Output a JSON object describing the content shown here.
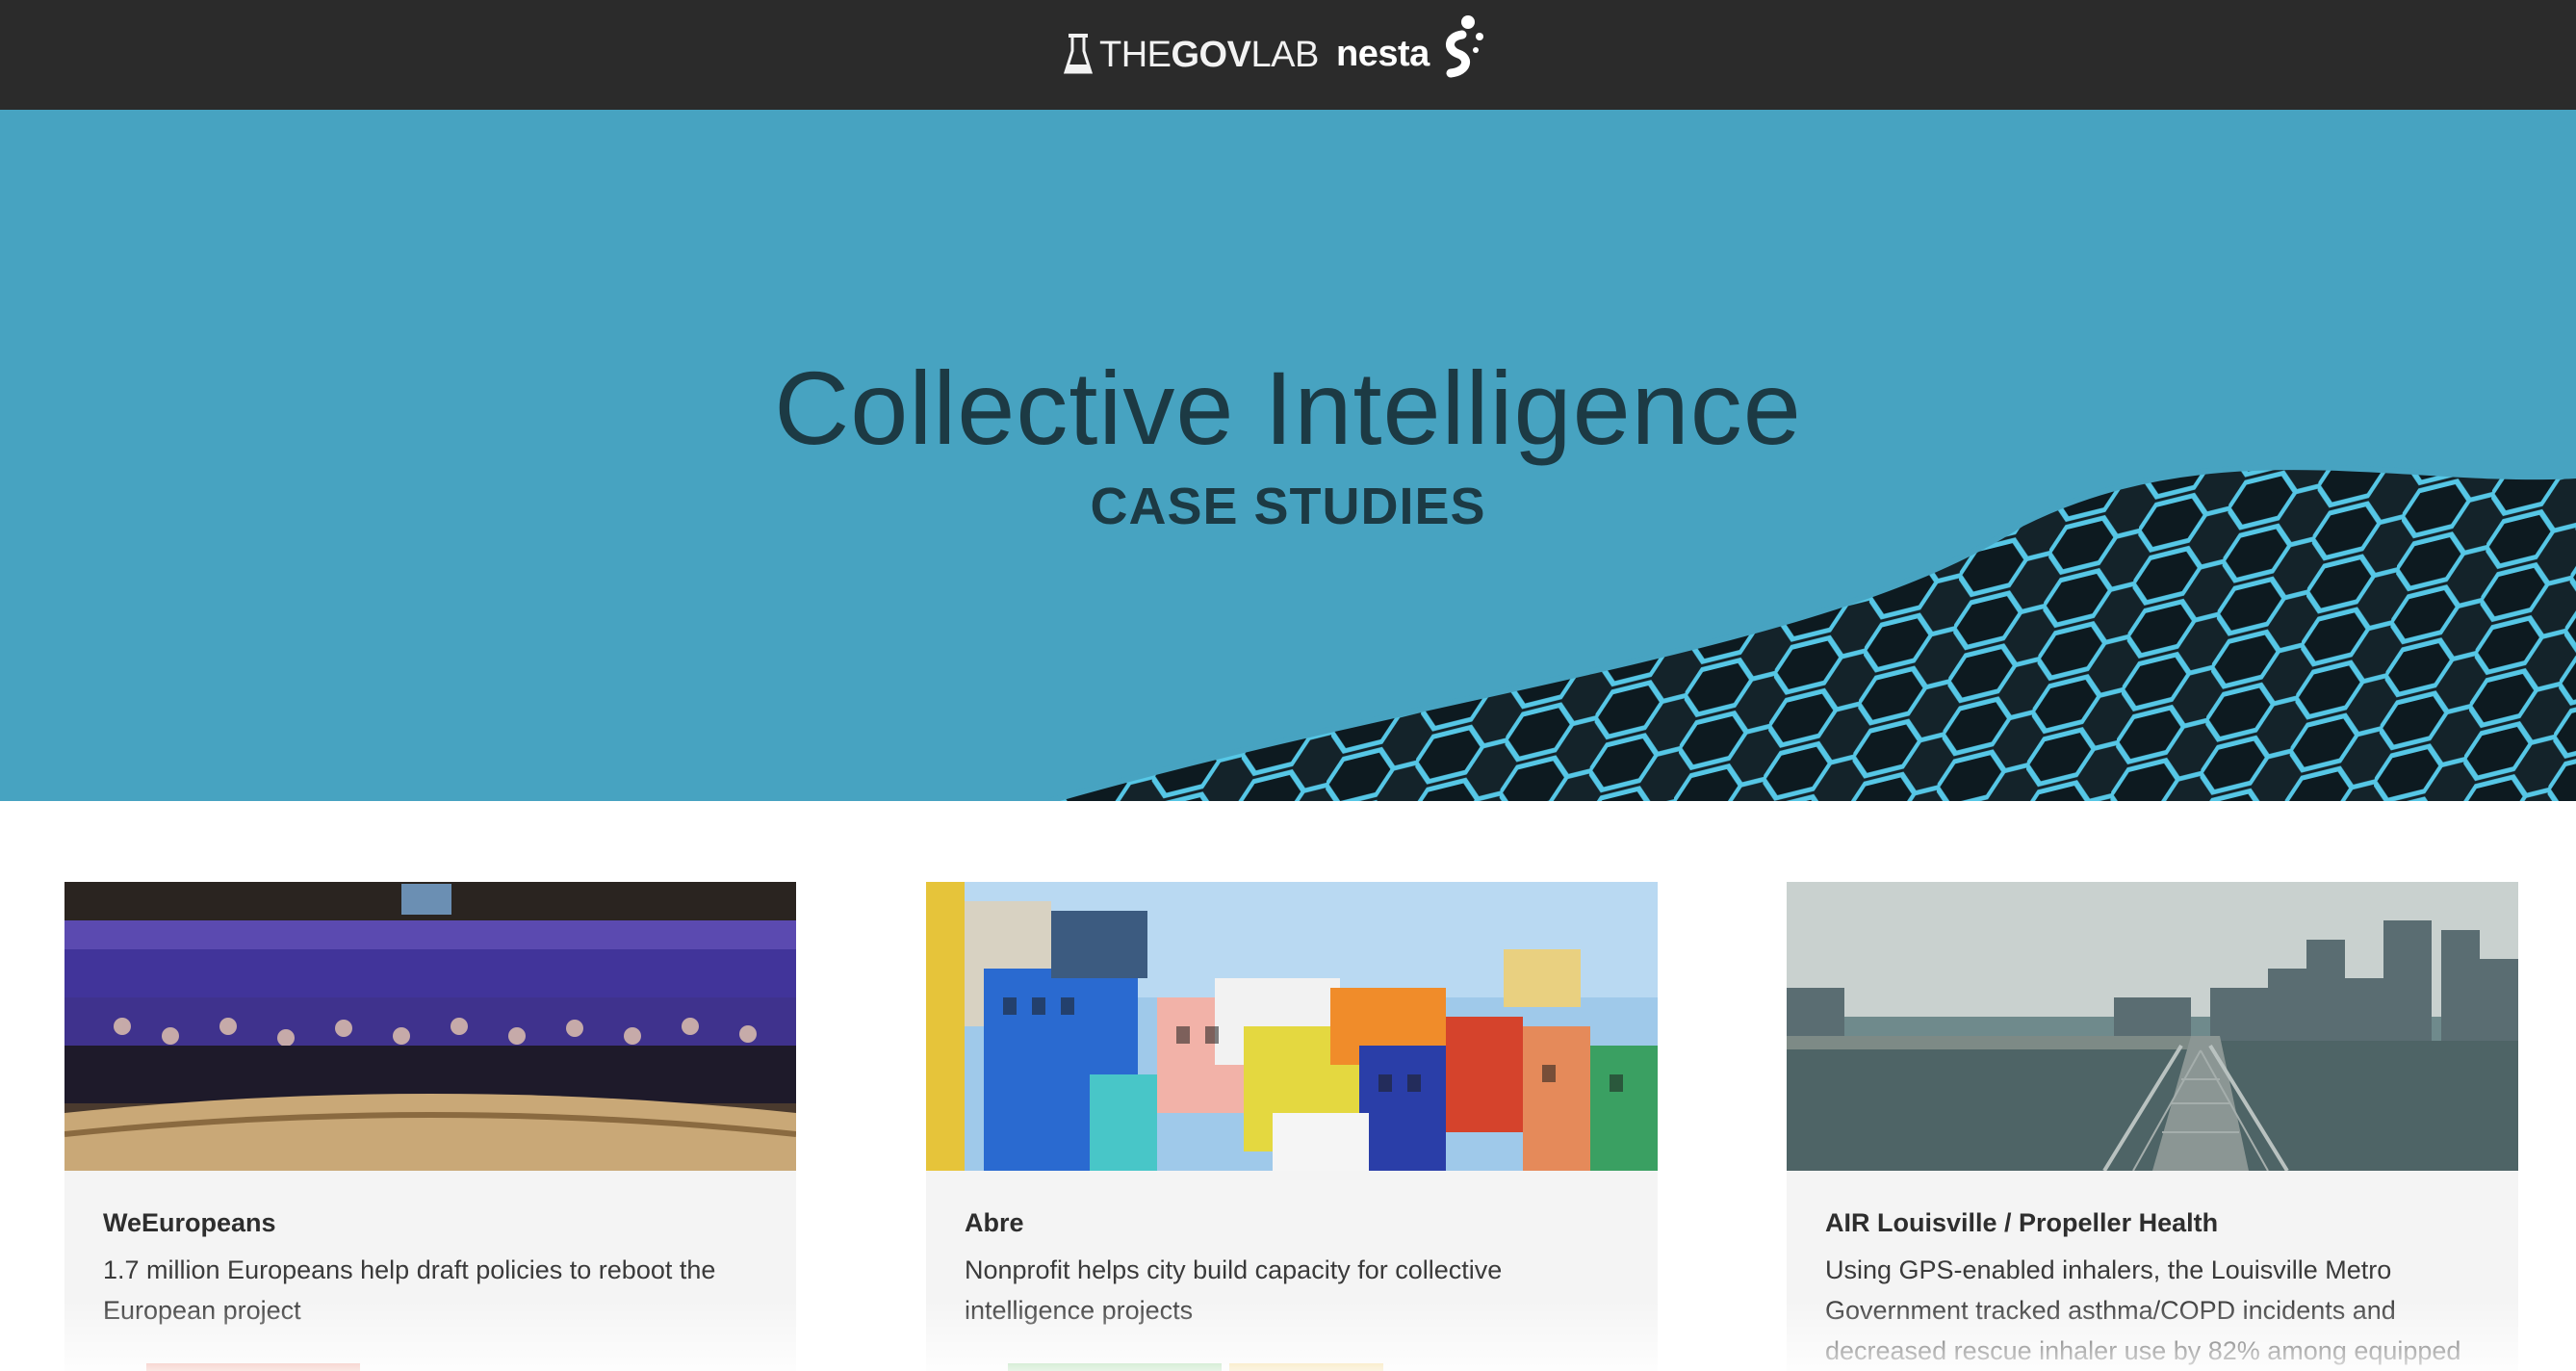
{
  "header": {
    "govlab_logo": {
      "the": "THE",
      "gov": "GOV",
      "lab": "LAB"
    },
    "nesta_logo": {
      "text": "nesta"
    }
  },
  "hero": {
    "title": "Collective Intelligence",
    "subtitle": "CASE STUDIES"
  },
  "colors": {
    "topbar": "#2b2b2b",
    "hero_bg": "#47a3c1",
    "hero_text": "#1c3a44",
    "card_bg": "#f4f4f4",
    "tag_red": "#e05a45",
    "tag_green": "#5cb85c",
    "tag_yellow": "#e8b83a"
  },
  "cards": [
    {
      "title": "WeEuropeans",
      "description": "1.7 million Europeans help draft policies to reboot the European project",
      "image_icon": "crowd-photo"
    },
    {
      "title": "Abre",
      "description": "Nonprofit helps city build capacity for collective intelligence projects",
      "image_icon": "colorful-houses-photo"
    },
    {
      "title": "AIR Louisville / Propeller Health",
      "description": "Using GPS-enabled inhalers, the Louisville Metro Government tracked asthma/COPD incidents and decreased rescue inhaler use by 82% among equipped",
      "image_icon": "city-skyline-photo"
    }
  ]
}
